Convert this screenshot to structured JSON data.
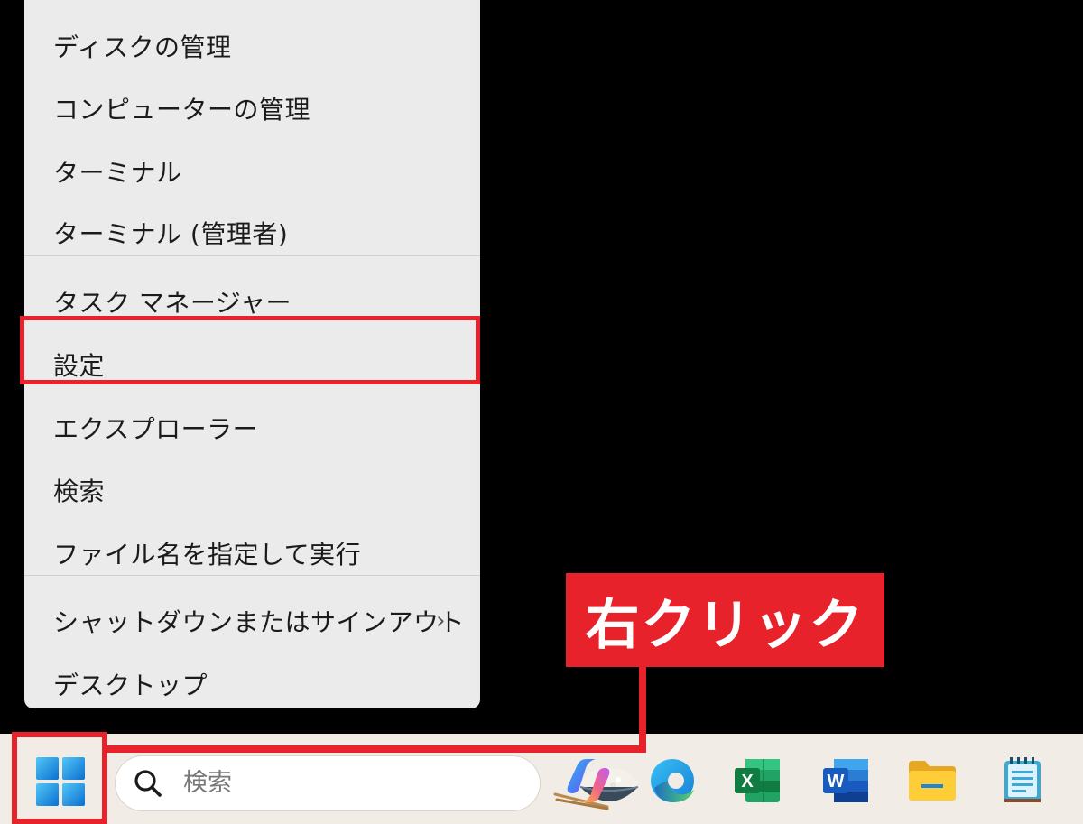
{
  "context_menu": {
    "items": [
      {
        "label": "ディスクの管理"
      },
      {
        "label": "コンピューターの管理"
      },
      {
        "label": "ターミナル"
      },
      {
        "label": "ターミナル (管理者)"
      },
      {
        "label": "タスク マネージャー"
      },
      {
        "label": "設定"
      },
      {
        "label": "エクスプローラー"
      },
      {
        "label": "検索"
      },
      {
        "label": "ファイル名を指定して実行"
      },
      {
        "label": "シャットダウンまたはサインアウト",
        "chevron": "›"
      },
      {
        "label": "デスクトップ"
      }
    ]
  },
  "annotation": {
    "callout": "右クリック",
    "highlight_color": "#e8222b"
  },
  "taskbar": {
    "search": {
      "placeholder": "検索"
    },
    "icons": [
      "windows-start-icon",
      "copilot-icon",
      "edge-icon",
      "excel-icon",
      "word-icon",
      "file-explorer-icon",
      "notepad-icon"
    ]
  }
}
